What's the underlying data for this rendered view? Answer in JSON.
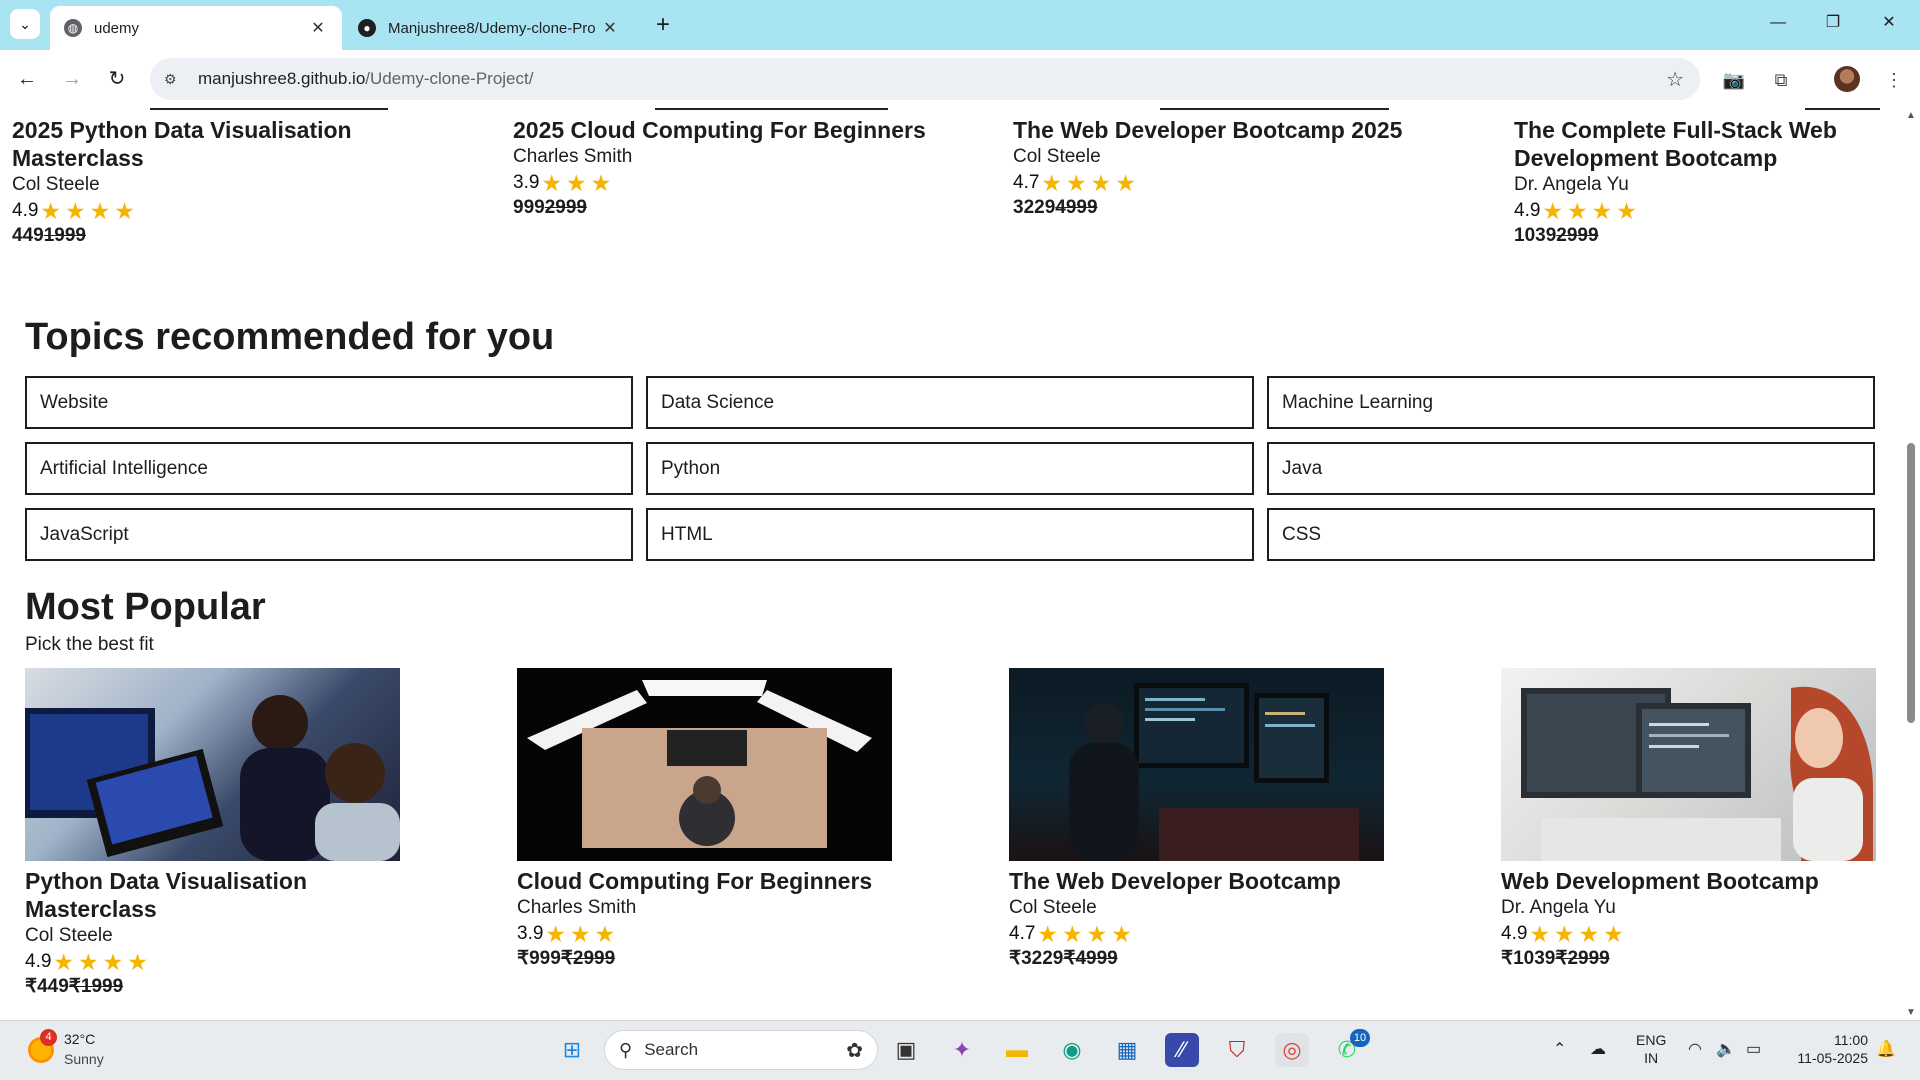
{
  "browser": {
    "tabs": [
      {
        "title": "udemy",
        "active": true
      },
      {
        "title": "Manjushree8/Udemy-clone-Pro",
        "active": false
      }
    ],
    "url_host": "manjushree8.github.io",
    "url_path": "/Udemy-clone-Project/",
    "icons": {
      "tab_menu": "⌄",
      "close": "✕",
      "new_tab": "+",
      "back": "←",
      "forward": "→",
      "reload": "↻",
      "site_info": "⚙",
      "bookmark": "☆",
      "camera": "📷",
      "extensions": "⧉",
      "menu": "⋮",
      "minimize": "—",
      "restore": "❐",
      "window_close": "✕"
    }
  },
  "top_courses": [
    {
      "title": "2025 Python Data Visualisation Masterclass",
      "author": "Col Steele",
      "rating": "4.9",
      "stars": "★★★★",
      "price": "449",
      "old_price": "1999"
    },
    {
      "title": "2025 Cloud Computing For Beginners",
      "author": "Charles Smith",
      "rating": "3.9",
      "stars": "★★★",
      "price": "999",
      "old_price": "2999"
    },
    {
      "title": "The Web Developer Bootcamp 2025",
      "author": "Col Steele",
      "rating": "4.7",
      "stars": "★★★★",
      "price": "3229",
      "old_price": "4999"
    },
    {
      "title": "The Complete Full-Stack Web Development Bootcamp",
      "author": "Dr. Angela Yu",
      "rating": "4.9",
      "stars": "★★★★",
      "price": "1039",
      "old_price": "2999"
    }
  ],
  "topics_section": {
    "title": "Topics recommended for you",
    "topics": [
      "Website",
      "Data Science",
      "Machine Learning",
      "Artificial Intelligence",
      "Python",
      "Java",
      "JavaScript",
      "HTML",
      "CSS"
    ]
  },
  "popular_section": {
    "title": "Most Popular",
    "subtitle": "Pick the best fit",
    "courses": [
      {
        "title": "Python Data Visualisation Masterclass",
        "author": "Col Steele",
        "rating": "4.9",
        "stars": "★★★★",
        "price": "₹449",
        "old_price": "₹1999"
      },
      {
        "title": "Cloud Computing For Beginners",
        "author": "Charles Smith",
        "rating": "3.9",
        "stars": "★★★",
        "price": "₹999",
        "old_price": "₹2999"
      },
      {
        "title": "The Web Developer Bootcamp",
        "author": "Col Steele",
        "rating": "4.7",
        "stars": "★★★★",
        "price": "₹3229",
        "old_price": "₹4999"
      },
      {
        "title": "Web Development Bootcamp",
        "author": "Dr. Angela Yu",
        "rating": "4.9",
        "stars": "★★★★",
        "price": "₹1039",
        "old_price": "₹2999"
      }
    ]
  },
  "taskbar": {
    "weather_temp": "32°C",
    "weather_desc": "Sunny",
    "weather_badge": "4",
    "search_placeholder": "Search",
    "whatsapp_badge": "10",
    "lang_line1": "ENG",
    "lang_line2": "IN",
    "time": "11:00",
    "date": "11-05-2025",
    "colors": {
      "accent": "#1565c0"
    }
  }
}
